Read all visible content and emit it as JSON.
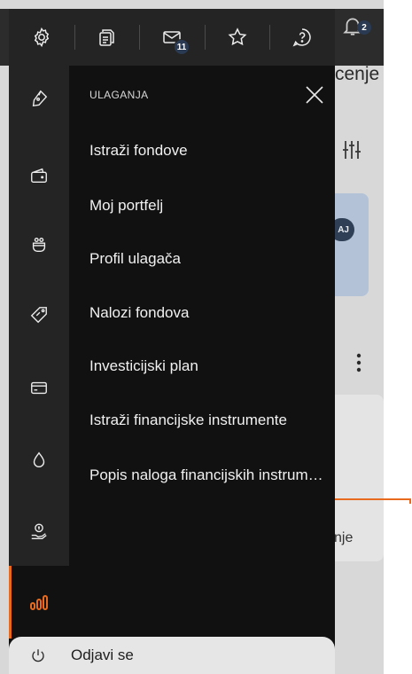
{
  "toolbar": {
    "items": [
      {
        "icon": "gear-icon"
      },
      {
        "icon": "documents-icon"
      },
      {
        "icon": "mail-icon",
        "badge": "11"
      },
      {
        "icon": "star-icon"
      },
      {
        "icon": "help-icon"
      }
    ]
  },
  "background": {
    "title_fragment": "cenje",
    "bell_badge": "2",
    "chip_fragment": "AJ",
    "panel_text_fragment": "nje"
  },
  "drawer": {
    "section_title": "ULAGANJA",
    "menu_items": [
      "Istraži fondove",
      "Moj portfelj",
      "Profil ulagača",
      "Nalozi fondova",
      "Investicijski plan",
      "Istraži financijske instrumente",
      "Popis naloga financijskih instrumenata"
    ],
    "rail_icons": [
      "pen-nib-icon",
      "wallet-icon",
      "piggy-pot-icon",
      "tag-icon",
      "credit-card-icon",
      "drop-icon",
      "hand-coin-icon",
      "investment-bars-icon"
    ]
  },
  "logout": {
    "label": "Odjavi se"
  },
  "colors": {
    "accent": "#e86a1e",
    "drawer_bg": "#111111",
    "rail_bg": "#242424",
    "badge_bg": "#2a3a52"
  }
}
